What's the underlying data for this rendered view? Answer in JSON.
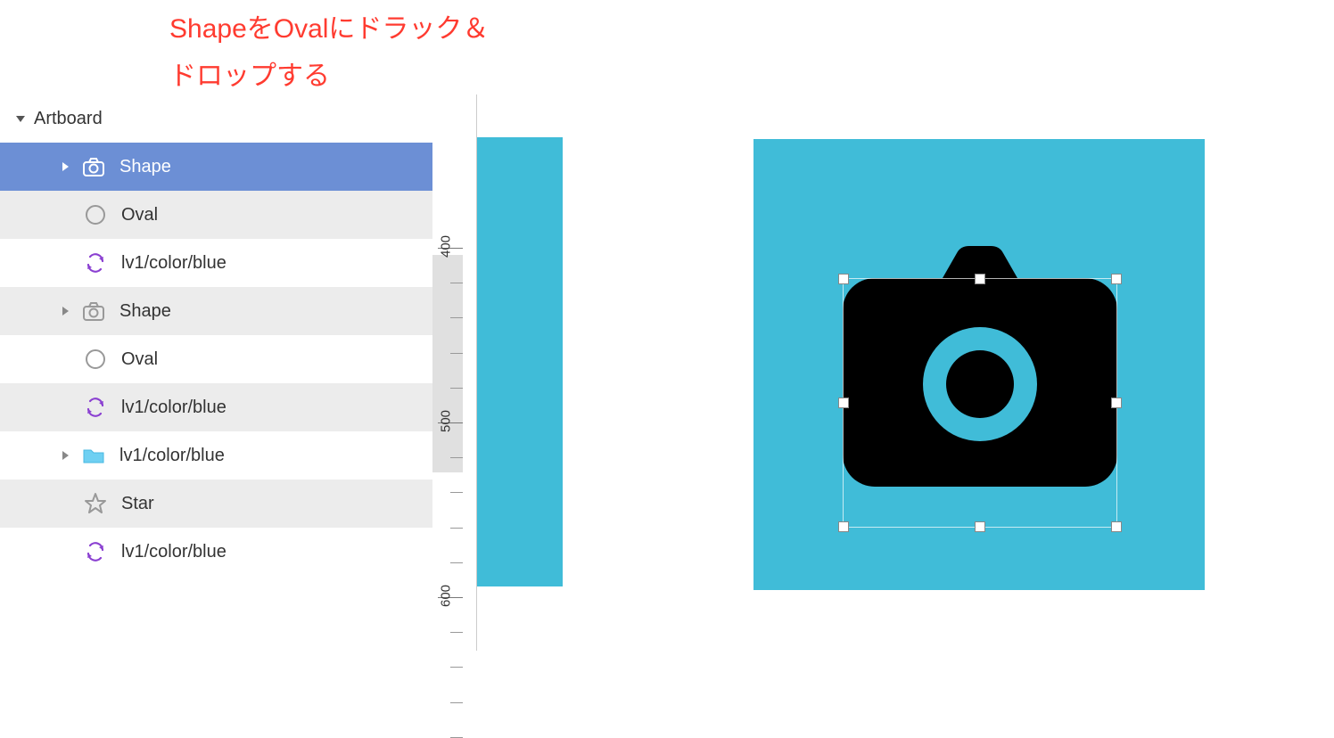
{
  "annotation": {
    "line1": "ShapeをOvalにドラック＆",
    "line2": "ドロップする"
  },
  "colors": {
    "accent_blue": "#6c8fd5",
    "canvas_blue": "#40bcd8",
    "annotation_red": "#ff3b30"
  },
  "layers_panel": {
    "root": {
      "label": "Artboard",
      "expanded": true
    },
    "items": [
      {
        "label": "Shape",
        "icon": "camera-icon",
        "indent": 1,
        "selected": true,
        "disclosure": "right"
      },
      {
        "label": "Oval",
        "icon": "oval-icon",
        "indent": 2,
        "alt": true
      },
      {
        "label": "lv1/color/blue",
        "icon": "sync-icon",
        "indent": 2,
        "alt": false
      },
      {
        "label": "Shape",
        "icon": "camera-icon",
        "indent": 1,
        "alt": true,
        "disclosure": "right-grey"
      },
      {
        "label": "Oval",
        "icon": "oval-icon",
        "indent": 2,
        "alt": false
      },
      {
        "label": "lv1/color/blue",
        "icon": "sync-icon",
        "indent": 2,
        "alt": true
      },
      {
        "label": "lv1/color/blue",
        "icon": "folder-icon",
        "indent": 1,
        "alt": false,
        "disclosure": "right-grey"
      },
      {
        "label": "Star",
        "icon": "star-icon",
        "indent": 2,
        "alt": true
      },
      {
        "label": "lv1/color/blue",
        "icon": "sync-icon",
        "indent": 2,
        "alt": false
      }
    ]
  },
  "ruler": {
    "labels": [
      {
        "value": "400",
        "pos": 172
      },
      {
        "value": "500",
        "pos": 368
      },
      {
        "value": "600",
        "pos": 564
      }
    ]
  }
}
